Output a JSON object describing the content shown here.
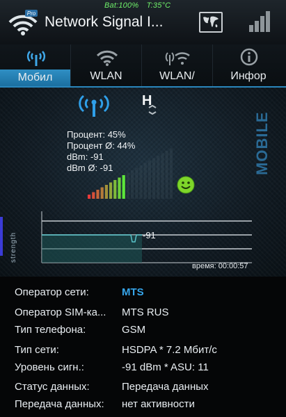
{
  "status": {
    "battery": "Bat:100%",
    "temp": "T:35°C"
  },
  "header": {
    "title": "Network Signal I...",
    "app_icon": "wifi-pro-icon",
    "map_icon": "world-map-icon",
    "signal_icon": "signal-bars-icon"
  },
  "tabs": [
    {
      "label": "Мобил",
      "icon": "antenna-icon",
      "active": true
    },
    {
      "label": "WLAN",
      "icon": "wifi-icon",
      "active": false
    },
    {
      "label": "WLAN/",
      "icon": "wifi-antenna-icon",
      "active": false
    },
    {
      "label": "Инфор",
      "icon": "info-icon",
      "active": false
    }
  ],
  "panel": {
    "vertical_label": "MOBILE",
    "percent": "Процент: 45%",
    "percent_avg": "Процент Ø: 44%",
    "dbm": "dBm: -91",
    "dbm_avg": "dBm Ø: -91",
    "network_type_badge": "H",
    "signal_level_fraction": 0.45,
    "graph_ylabel": "strength",
    "graph_value": "-91",
    "graph_time": "время: 00:00:57",
    "bar_color_low": "#e83a3a",
    "bar_color_high": "#5ce63a"
  },
  "rows": [
    {
      "key": "Оператор сети:",
      "value": "MTS",
      "highlight": true
    },
    {
      "key": "Оператор SIM-ка...",
      "value": "MTS RUS",
      "highlight": false
    },
    {
      "key": "Тип телефона:",
      "value": "GSM",
      "highlight": false
    },
    {
      "key": "Тип сети:",
      "value": "HSDPA * 7.2 Мбит/с",
      "highlight": false
    },
    {
      "key": "Уровень сигн.:",
      "value": "-91 dBm * ASU: 11",
      "highlight": false
    },
    {
      "key": "Статус данных:",
      "value": "Передача данных",
      "highlight": false
    },
    {
      "key": "Передача данных:",
      "value": "нет активности",
      "highlight": false
    }
  ]
}
